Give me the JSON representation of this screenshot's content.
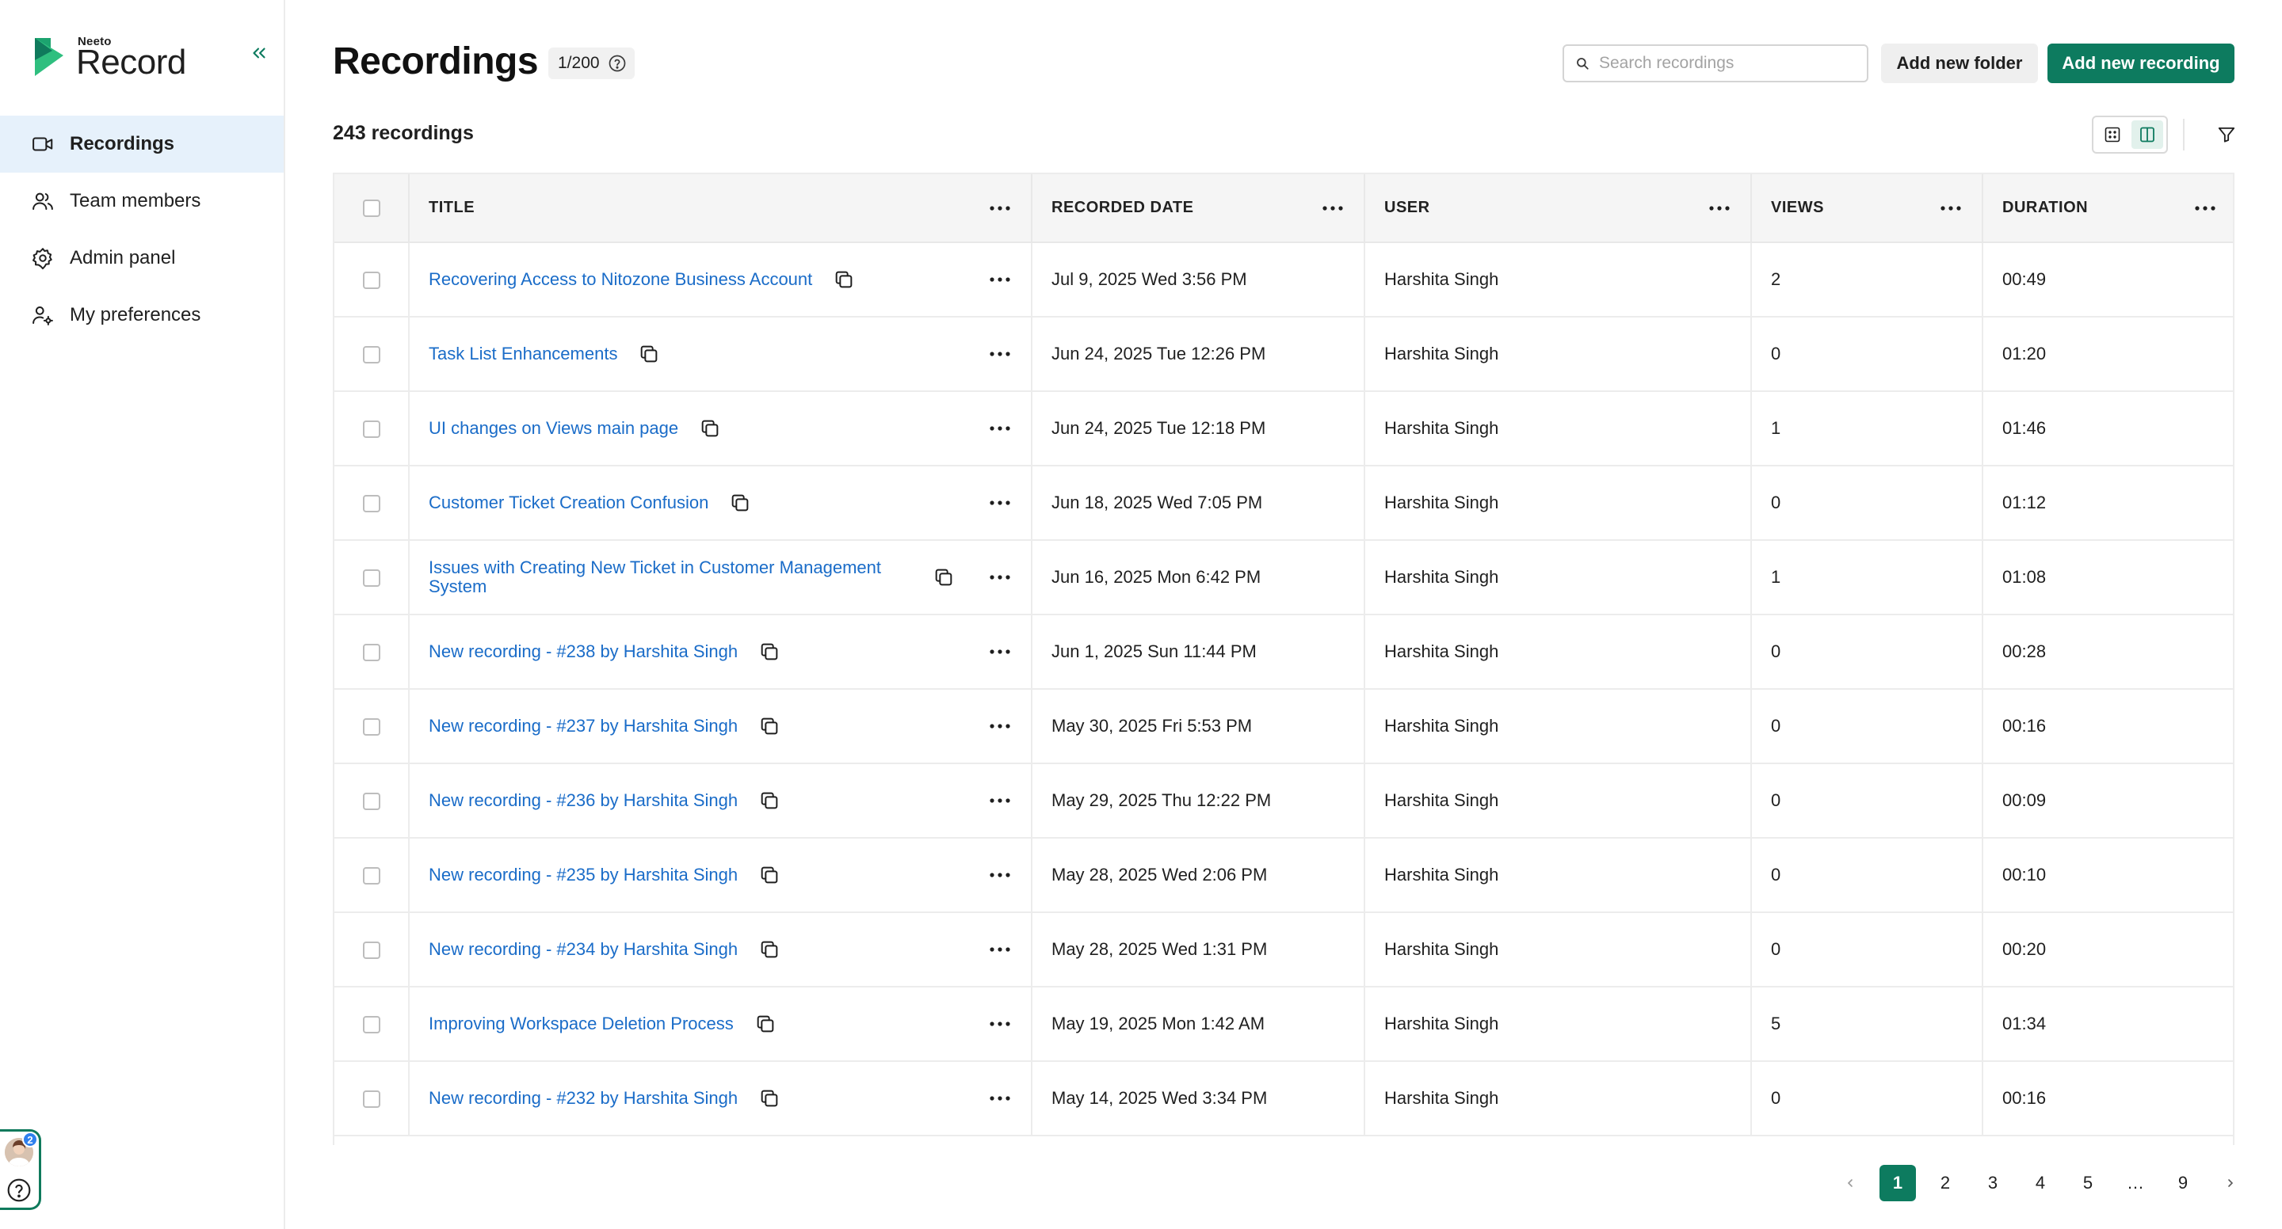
{
  "brand": {
    "small": "Neeto",
    "big": "Record"
  },
  "sidebar": {
    "items": [
      {
        "label": "Recordings",
        "icon": "video-camera-icon"
      },
      {
        "label": "Team members",
        "icon": "users-icon"
      },
      {
        "label": "Admin panel",
        "icon": "gear-icon"
      },
      {
        "label": "My preferences",
        "icon": "user-settings-icon"
      }
    ],
    "help_badge": "2"
  },
  "header": {
    "title": "Recordings",
    "quota": "1/200",
    "search_placeholder": "Search recordings",
    "add_folder_label": "Add new folder",
    "add_recording_label": "Add new recording",
    "count": "243 recordings"
  },
  "table": {
    "columns": [
      "TITLE",
      "RECORDED DATE",
      "USER",
      "VIEWS",
      "DURATION"
    ],
    "rows": [
      {
        "title": "Recovering Access to Nitozone Business Account",
        "date": "Jul 9, 2025 Wed 3:56 PM",
        "user": "Harshita Singh",
        "views": "2",
        "duration": "00:49"
      },
      {
        "title": "Task List Enhancements",
        "date": "Jun 24, 2025 Tue 12:26 PM",
        "user": "Harshita Singh",
        "views": "0",
        "duration": "01:20"
      },
      {
        "title": "UI changes on Views main page",
        "date": "Jun 24, 2025 Tue 12:18 PM",
        "user": "Harshita Singh",
        "views": "1",
        "duration": "01:46"
      },
      {
        "title": "Customer Ticket Creation Confusion",
        "date": "Jun 18, 2025 Wed 7:05 PM",
        "user": "Harshita Singh",
        "views": "0",
        "duration": "01:12"
      },
      {
        "title": "Issues with Creating New Ticket in Customer Management System",
        "date": "Jun 16, 2025 Mon 6:42 PM",
        "user": "Harshita Singh",
        "views": "1",
        "duration": "01:08"
      },
      {
        "title": "New recording - #238 by Harshita Singh",
        "date": "Jun 1, 2025 Sun 11:44 PM",
        "user": "Harshita Singh",
        "views": "0",
        "duration": "00:28"
      },
      {
        "title": "New recording - #237 by Harshita Singh",
        "date": "May 30, 2025 Fri 5:53 PM",
        "user": "Harshita Singh",
        "views": "0",
        "duration": "00:16"
      },
      {
        "title": "New recording - #236 by Harshita Singh",
        "date": "May 29, 2025 Thu 12:22 PM",
        "user": "Harshita Singh",
        "views": "0",
        "duration": "00:09"
      },
      {
        "title": "New recording - #235 by Harshita Singh",
        "date": "May 28, 2025 Wed 2:06 PM",
        "user": "Harshita Singh",
        "views": "0",
        "duration": "00:10"
      },
      {
        "title": "New recording - #234 by Harshita Singh",
        "date": "May 28, 2025 Wed 1:31 PM",
        "user": "Harshita Singh",
        "views": "0",
        "duration": "00:20"
      },
      {
        "title": "Improving Workspace Deletion Process",
        "date": "May 19, 2025 Mon 1:42 AM",
        "user": "Harshita Singh",
        "views": "5",
        "duration": "01:34"
      },
      {
        "title": "New recording - #232 by Harshita Singh",
        "date": "May 14, 2025 Wed 3:34 PM",
        "user": "Harshita Singh",
        "views": "0",
        "duration": "00:16"
      }
    ]
  },
  "pagination": {
    "pages": [
      "1",
      "2",
      "3",
      "4",
      "5",
      "…",
      "9"
    ],
    "current": "1"
  },
  "colors": {
    "primary": "#0d7b5f",
    "link": "#1a6cc8",
    "active_nav_bg": "#e6f1fb"
  }
}
